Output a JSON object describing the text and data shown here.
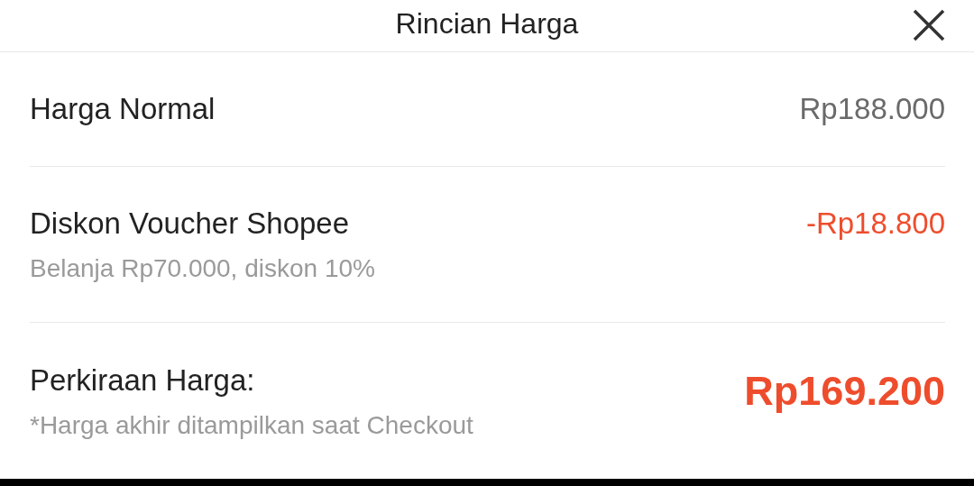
{
  "header": {
    "title": "Rincian Harga"
  },
  "rows": [
    {
      "kind": "normal",
      "label": "Harga Normal",
      "value": "Rp188.000"
    },
    {
      "kind": "discount",
      "label": "Diskon Voucher Shopee",
      "note": "Belanja Rp70.000, diskon 10%",
      "value": "-Rp18.800"
    },
    {
      "kind": "total",
      "label": "Perkiraan Harga:",
      "note": "*Harga akhir ditampilkan saat Checkout",
      "value": "Rp169.200"
    }
  ]
}
